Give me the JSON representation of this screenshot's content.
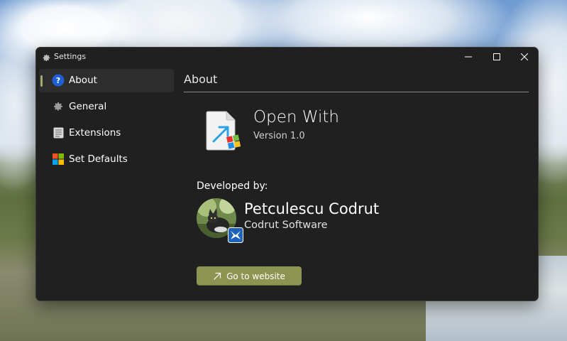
{
  "window": {
    "title": "Settings",
    "icon": "gear-icon"
  },
  "nav": {
    "items": [
      {
        "label": "About",
        "icon": "about-icon",
        "selected": true
      },
      {
        "label": "General",
        "icon": "gear-icon",
        "selected": false
      },
      {
        "label": "Extensions",
        "icon": "document-list-icon",
        "selected": false
      },
      {
        "label": "Set Defaults",
        "icon": "windows-logo-icon",
        "selected": false
      }
    ]
  },
  "page": {
    "title": "About"
  },
  "app": {
    "name": "Open With",
    "version": "Version 1.0",
    "icon": "open-with-app-icon"
  },
  "developer": {
    "label": "Developed by:",
    "name": "Petculescu Codrut",
    "company": "Codrut Software",
    "avatar": "developer-avatar",
    "badge": "codrut-software-logo-icon"
  },
  "actions": {
    "website_label": "Go to website"
  },
  "colors": {
    "accent": "#8d9451",
    "selected_indicator": "#a3aa6a",
    "window_bg": "#202020",
    "nav_selected_bg": "#2d2d2d"
  }
}
